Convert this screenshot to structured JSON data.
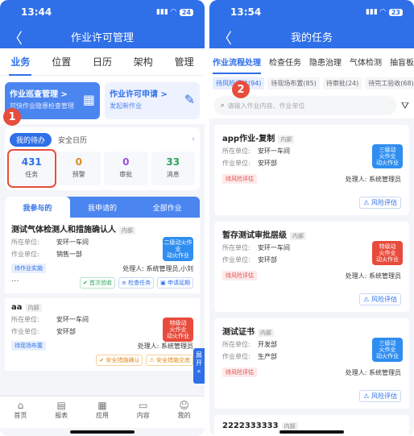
{
  "left": {
    "status": {
      "time": "13:44",
      "signal": "•ıl",
      "battery": "24"
    },
    "nav": {
      "back": "〈",
      "title": "作业许可管理"
    },
    "tabs": [
      "业务",
      "位置",
      "日历",
      "架构",
      "管理"
    ],
    "cards": {
      "patrol": {
        "title": "作业巡查管理 >",
        "sub": "可快作业隐患检查管理"
      },
      "apply": {
        "title": "作业许可申请 >",
        "sub": "发起新作业"
      }
    },
    "todo": {
      "pill": "我的待办",
      "calendar": "安全日历",
      "chev": "›"
    },
    "stats": [
      {
        "n": "431",
        "l": "任务",
        "color": "#2f6fe8"
      },
      {
        "n": "0",
        "l": "预警",
        "color": "#e08a1b"
      },
      {
        "n": "0",
        "l": "审批",
        "color": "#9b51e0"
      },
      {
        "n": "33",
        "l": "消息",
        "color": "#2ea35b"
      }
    ],
    "segments": [
      "我参与的",
      "我申请的",
      "全部作业"
    ],
    "items": [
      {
        "title": "测试气体检测人和措施确认人",
        "tag": "内部",
        "unit_k": "所在单位:",
        "unit_v": "安环一车间",
        "dept_k": "作业单位:",
        "dept_v": "销售一部",
        "level": "二级动火作业\n动火作业",
        "status": "待作业实施",
        "handler": "处理人: 系统管理员,小刘",
        "btns": [
          "✔ 首次验收",
          "≡ 检查任务",
          "▣ 申请延期"
        ],
        "dots": "···"
      },
      {
        "title": "aa",
        "tag": "内部",
        "unit_k": "所在单位:",
        "unit_v": "安环一车间",
        "dept_k": "作业单位:",
        "dept_v": "安环部",
        "level": "特级动\n火作业\n动火作业",
        "status": "待现场布置",
        "handler": "处理人: 系统管理员",
        "btns": [
          "✔ 安全措施确认",
          "⚠ 安全措施交底"
        ]
      }
    ],
    "expand": "展\n开\n«",
    "bottomnav": [
      {
        "icon": "⌂",
        "label": "首页"
      },
      {
        "icon": "▤",
        "label": "报表"
      },
      {
        "icon": "▦",
        "label": "应用"
      },
      {
        "icon": "▭",
        "label": "内容"
      },
      {
        "icon": "☺",
        "label": "我的"
      }
    ],
    "callout": "1"
  },
  "right": {
    "status": {
      "time": "13:54",
      "battery": "23"
    },
    "nav": {
      "back": "〈",
      "title": "我的任务"
    },
    "tabs": [
      "作业流程处理",
      "检查任务",
      "隐患治理",
      "气体检测",
      "抽盲板"
    ],
    "subtabs": [
      "待风险评估(94)",
      "待现场布置(85)",
      "待审批(24)",
      "待完工验收(68)"
    ],
    "search": {
      "placeholder": "请输入作业内容、作业单位"
    },
    "items": [
      {
        "title": "app作业-复制",
        "tag": "内部",
        "unit_k": "所在单位:",
        "unit_v": "安环一车间",
        "dept_k": "作业单位:",
        "dept_v": "安环部",
        "level": "三级动\n火作业\n动火作业",
        "status": "待风险评估",
        "handler": "处理人: 系统管理员",
        "btn": "⚠ 风险评估"
      },
      {
        "title": "暂存测试审批层级",
        "tag": "内部",
        "unit_k": "所在单位:",
        "unit_v": "安环一车间",
        "dept_k": "作业单位:",
        "dept_v": "安环部",
        "level": "特级动\n火作业\n动火作业",
        "status": "待风险评估",
        "handler": "处理人: 系统管理员",
        "btn": "⚠ 风险评估"
      },
      {
        "title": "测试证书",
        "tag": "内部",
        "unit_k": "所在单位:",
        "unit_v": "开发部",
        "dept_k": "作业单位:",
        "dept_v": "生产部",
        "level": "三级动\n火作业\n动火作业",
        "status": "待风险评估",
        "handler": "处理人: 系统管理员",
        "btn": "⚠ 风险评估"
      }
    ],
    "last_title": "2222333333",
    "last_tag": "内部",
    "callout": "2"
  }
}
